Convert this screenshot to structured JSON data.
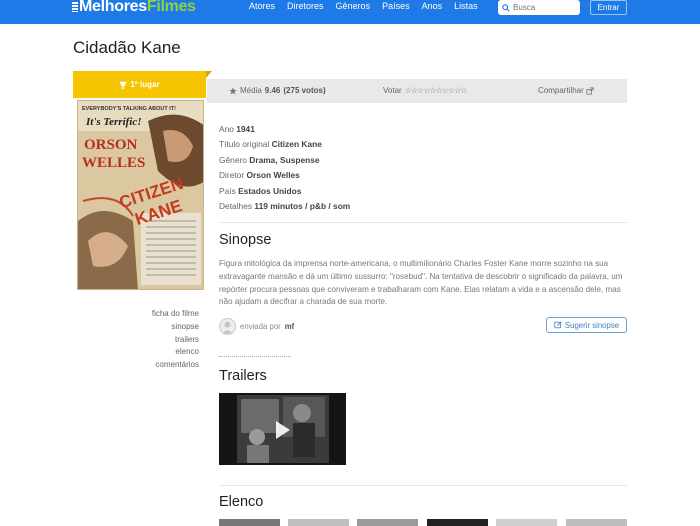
{
  "header": {
    "logo_part1": "Melhores",
    "logo_part2": "Filmes",
    "nav": [
      "Atores",
      "Diretores",
      "Gêneros",
      "Países",
      "Anos",
      "Listas"
    ],
    "search_placeholder": "Busca",
    "login_label": "Entrar"
  },
  "movie": {
    "title": "Cidadão Kane",
    "rank_label": "1º lugar",
    "poster_texts": {
      "tagline": "EVERYBODY'S TALKING ABOUT IT!",
      "quote": "It's Terrific!",
      "star": "ORSON WELLES",
      "film_title": "CITIZEN KANE"
    }
  },
  "stats": {
    "average_label": "Média",
    "average_value": "9.46",
    "votes_count": "(275 votos)",
    "vote_label": "Votar",
    "share_label": "Compartilhar"
  },
  "sidebar_links": [
    "ficha do filme",
    "sinopse",
    "trailers",
    "elenco",
    "comentários"
  ],
  "info": [
    {
      "label": "Ano",
      "value": "1941"
    },
    {
      "label": "Título original",
      "value": "Citizen Kane"
    },
    {
      "label": "Gênero",
      "value": "Drama, Suspense"
    },
    {
      "label": "Diretor",
      "value": "Orson Welles"
    },
    {
      "label": "País",
      "value": "Estados Unidos"
    },
    {
      "label": "Detalhes",
      "value": "119 minutos / p&b / som"
    }
  ],
  "synopsis": {
    "heading": "Sinopse",
    "text": "Figura mitológica da imprensa norte-americana, o multimilionário Charles Foster Kane morre sozinho na sua extravagante mansão e dá um último sussurro: \"rosebud\". Na tentativa de descobrir o significado da palavra, um repórter procura pessoas que conviveram e trabalharam com Kane. Elas relatam a vida e a ascensão dele, mas não ajudam a decifrar a charada de sua morte.",
    "sent_by_label": "enviada por",
    "sent_by_user": "mf",
    "suggest_label": "Sugerir sinopse"
  },
  "trailers": {
    "heading": "Trailers"
  },
  "cast": {
    "heading": "Elenco"
  },
  "colors": {
    "header_blue": "#1e7ae6",
    "logo_green": "#8fd13f",
    "rank_yellow": "#f7c500",
    "stats_bg": "#e9e9e9",
    "link_blue": "#3d7fc4"
  },
  "icons": [
    "search-icon",
    "trophy-icon",
    "star-icon",
    "share-icon",
    "pencil-icon",
    "play-icon",
    "user-icon"
  ]
}
